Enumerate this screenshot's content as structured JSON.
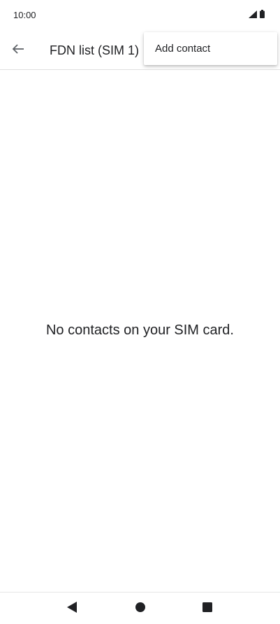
{
  "status_bar": {
    "time": "10:00",
    "icons": [
      "signal-icon",
      "battery-icon"
    ]
  },
  "app_bar": {
    "title": "FDN list (SIM 1)",
    "back_icon": "arrow-back-icon"
  },
  "overflow_menu": {
    "items": [
      {
        "label": "Add contact"
      }
    ]
  },
  "main": {
    "empty_message": "No contacts on your SIM card."
  },
  "nav_bar": {
    "buttons": [
      "back-triangle-icon",
      "home-circle-icon",
      "recents-square-icon"
    ]
  },
  "colors": {
    "text": "#202124",
    "icon": "#5f6368",
    "divider": "#e0e0e0",
    "background": "#ffffff"
  }
}
